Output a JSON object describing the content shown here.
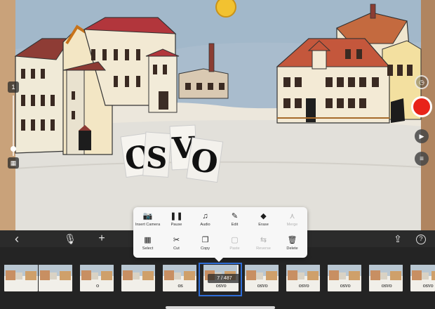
{
  "viewport": {
    "word_letters": [
      "O",
      "S",
      "V",
      "O"
    ],
    "word_label": "OSVO"
  },
  "left_rail": {
    "top_icon": "1",
    "bottom_icon": "grid-icon"
  },
  "right_controls": {
    "timer_icon": "timer-icon",
    "record_icon": "record-icon",
    "play_icon": "▶",
    "menu_icon": "≡"
  },
  "toolbar": {
    "back": "‹",
    "mic": "mic-icon",
    "add": "+",
    "share": "share-icon",
    "help": "?"
  },
  "popup": {
    "row1": [
      {
        "label": "Insert Camera",
        "icon": "📷",
        "enabled": true
      },
      {
        "label": "Pause",
        "icon": "❚❚",
        "enabled": true
      },
      {
        "label": "Audio",
        "icon": "♫",
        "enabled": true
      },
      {
        "label": "Edit",
        "icon": "✎",
        "enabled": true
      },
      {
        "label": "Erase",
        "icon": "◆",
        "enabled": true
      },
      {
        "label": "Merge",
        "icon": "⋏",
        "enabled": false
      }
    ],
    "row2": [
      {
        "label": "Select",
        "icon": "▦",
        "enabled": true
      },
      {
        "label": "Cut",
        "icon": "✂",
        "enabled": true
      },
      {
        "label": "Copy",
        "icon": "❐",
        "enabled": true
      },
      {
        "label": "Paste",
        "icon": "▢",
        "enabled": false
      },
      {
        "label": "Reverse",
        "icon": "⇆",
        "enabled": false
      },
      {
        "label": "Delete",
        "icon": "🗑",
        "enabled": true
      }
    ]
  },
  "filmstrip": {
    "frame_counter": "7 / 487",
    "frames": [
      "",
      "",
      "o",
      "",
      "os",
      "osvo",
      "osvo",
      "osvo",
      "osvo",
      "osvo",
      "osvo"
    ]
  },
  "colors": {
    "accent_blue": "#2f6ed8",
    "record_red": "#e8231a",
    "toolbar_bg": "#2b2b2b"
  }
}
